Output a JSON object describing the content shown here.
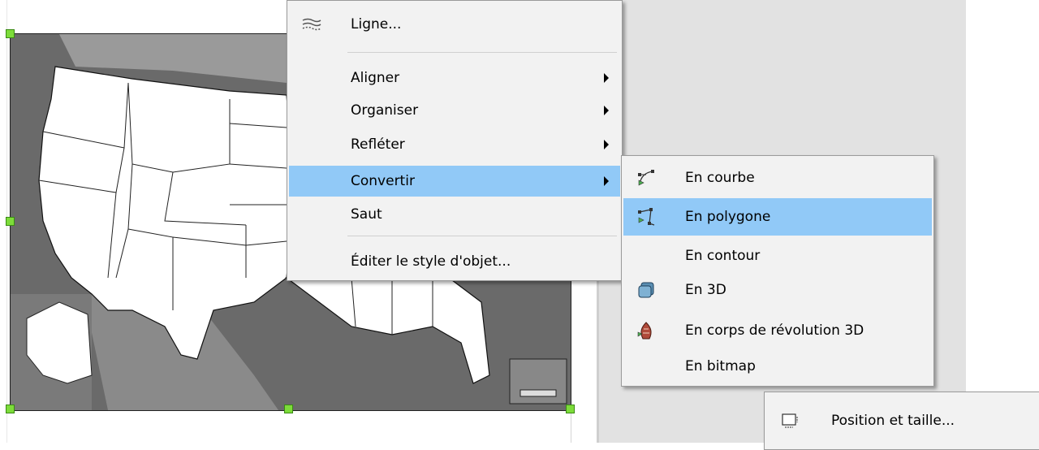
{
  "context_menu": {
    "items": [
      {
        "label": "Ligne...",
        "icon": "line-style-icon"
      },
      {
        "label": "Aligner",
        "submenu": true
      },
      {
        "label": "Organiser",
        "submenu": true
      },
      {
        "label": "Refléter",
        "submenu": true
      },
      {
        "label": "Convertir",
        "submenu": true,
        "highlighted": true
      },
      {
        "label": "Saut"
      },
      {
        "label": "Éditer le style d'objet..."
      }
    ]
  },
  "convert_submenu": {
    "items": [
      {
        "label": "En courbe",
        "icon": "bezier-curve-icon"
      },
      {
        "label": "En polygone",
        "icon": "polygon-icon",
        "highlighted": true
      },
      {
        "label": "En contour"
      },
      {
        "label": "En 3D",
        "icon": "cube-3d-icon"
      },
      {
        "label": "En corps de révolution 3D",
        "icon": "rotation-object-icon"
      },
      {
        "label": "En bitmap"
      }
    ]
  },
  "lower_menu": {
    "items": [
      {
        "label": "Position et taille...",
        "icon": "position-size-icon"
      }
    ]
  },
  "colors": {
    "highlight": "#91c9f7",
    "menu_bg": "#f2f2f2",
    "handle": "#7ddc3a",
    "map_bg": "#6e6e6e",
    "map_land": "#ffffff"
  }
}
